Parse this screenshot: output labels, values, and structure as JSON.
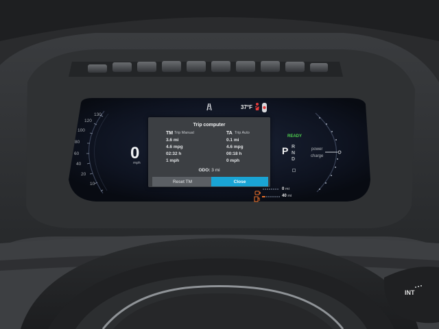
{
  "colors": {
    "dash_plastic": "#2b2d2f",
    "screen_bg": "#0f1420",
    "ready_green": "#4fd04f",
    "close_button": "#1aa4d4",
    "warning_red": "#e23b3b",
    "range_orange": "#f0722a"
  },
  "speedometer": {
    "ticks": [
      "130",
      "120",
      "100",
      "80",
      "60",
      "40",
      "20",
      "10"
    ],
    "speed": "0",
    "unit": "mph"
  },
  "status_bar": {
    "road_icon": "road-icon",
    "outside_temp": "37°F",
    "seatbelt_icon": "seatbelt-warning-icon"
  },
  "trip_computer": {
    "title": "Trip computer",
    "left": {
      "code": "TM",
      "name": "Trip Manual",
      "distance": "3.6 mi",
      "efficiency": "4.6 mpg",
      "time": "02:32 h",
      "avg_speed": "1 mph"
    },
    "right": {
      "code": "TA",
      "name": "Trip Auto",
      "distance": "0.1 mi",
      "efficiency": "4.6 mpg",
      "time": "00:18 h",
      "avg_speed": "0 mph"
    },
    "odo_label": "ODO:",
    "odo_value": "3 mi",
    "reset_label": "Reset TM",
    "close_label": "Close"
  },
  "gear": {
    "ready": "READY",
    "current": "P",
    "options": [
      "R",
      "N",
      "D"
    ]
  },
  "power_meter": {
    "power_label": "power",
    "charge_label": "charge"
  },
  "range": {
    "electric_icon": "ev-plug-icon",
    "electric_value": "0",
    "fuel_icon": "fuel-pump-icon",
    "fuel_value": "40",
    "unit": "mi"
  },
  "wiper_stalk": {
    "label": "INT"
  }
}
